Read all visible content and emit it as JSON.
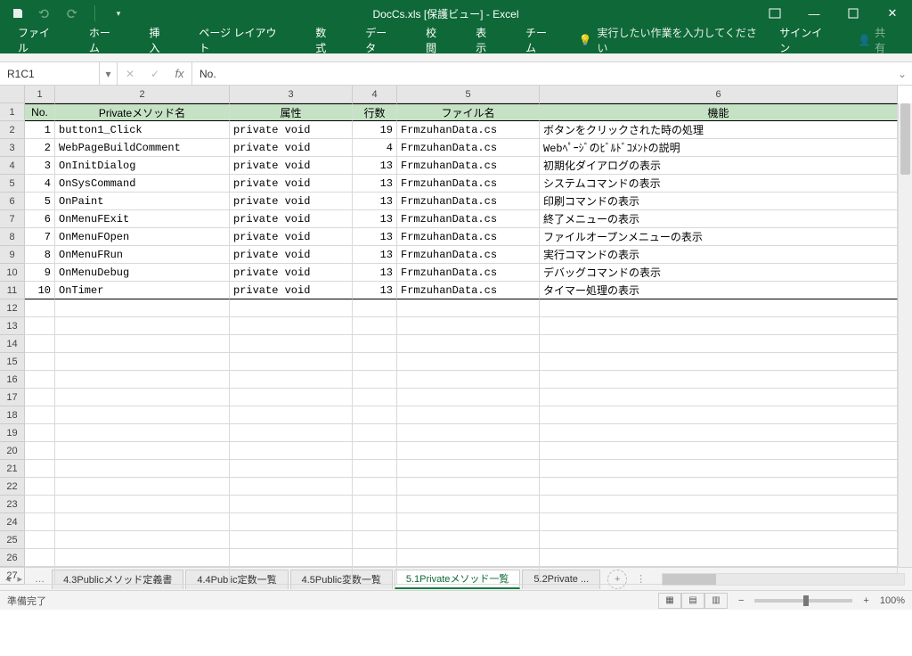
{
  "titlebar": {
    "title": "DocCs.xls  [保護ビュー] - Excel"
  },
  "ribbon": {
    "tabs": [
      "ファイル",
      "ホーム",
      "挿入",
      "ページ レイアウト",
      "数式",
      "データ",
      "校閲",
      "表示",
      "チーム"
    ],
    "tellme": "実行したい作業を入力してください",
    "signin": "サインイン",
    "share": "共有"
  },
  "formula": {
    "namebox": "R1C1",
    "fx": "fx",
    "content": "No."
  },
  "grid": {
    "col_headers": [
      "1",
      "2",
      "3",
      "4",
      "5",
      "6"
    ],
    "row_count": 27,
    "header_row": [
      "No.",
      "Privateメソッド名",
      "属性",
      "行数",
      "ファイル名",
      "機能"
    ],
    "rows": [
      [
        "1",
        "button1_Click",
        "private void",
        "19",
        "FrmzuhanData.cs",
        "ボタンをクリックされた時の処理"
      ],
      [
        "2",
        "WebPageBuildComment",
        "private void",
        "4",
        "FrmzuhanData.cs",
        "Webﾍﾟｰｼﾞのﾋﾞﾙﾄﾞｺﾒﾝﾄの説明"
      ],
      [
        "3",
        "OnInitDialog",
        "private void",
        "13",
        "FrmzuhanData.cs",
        "初期化ダイアログの表示"
      ],
      [
        "4",
        "OnSysCommand",
        "private void",
        "13",
        "FrmzuhanData.cs",
        "システムコマンドの表示"
      ],
      [
        "5",
        "OnPaint",
        "private void",
        "13",
        "FrmzuhanData.cs",
        "印刷コマンドの表示"
      ],
      [
        "6",
        "OnMenuFExit",
        "private void",
        "13",
        "FrmzuhanData.cs",
        "終了メニューの表示"
      ],
      [
        "7",
        "OnMenuFOpen",
        "private void",
        "13",
        "FrmzuhanData.cs",
        "ファイルオープンメニューの表示"
      ],
      [
        "8",
        "OnMenuFRun",
        "private void",
        "13",
        "FrmzuhanData.cs",
        "実行コマンドの表示"
      ],
      [
        "9",
        "OnMenuDebug",
        "private void",
        "13",
        "FrmzuhanData.cs",
        "デバッグコマンドの表示"
      ],
      [
        "10",
        "OnTimer",
        "private void",
        "13",
        "FrmzuhanData.cs",
        "タイマー処理の表示"
      ]
    ]
  },
  "sheets": {
    "tabs": [
      "4.3Publicメソッド定義書",
      "4.4Public定数一覧",
      "4.5Public変数一覧",
      "5.1Privateメソッド一覧",
      "5.2Private ..."
    ],
    "active_index": 3
  },
  "status": {
    "ready": "準備完了",
    "zoom": "100%"
  }
}
